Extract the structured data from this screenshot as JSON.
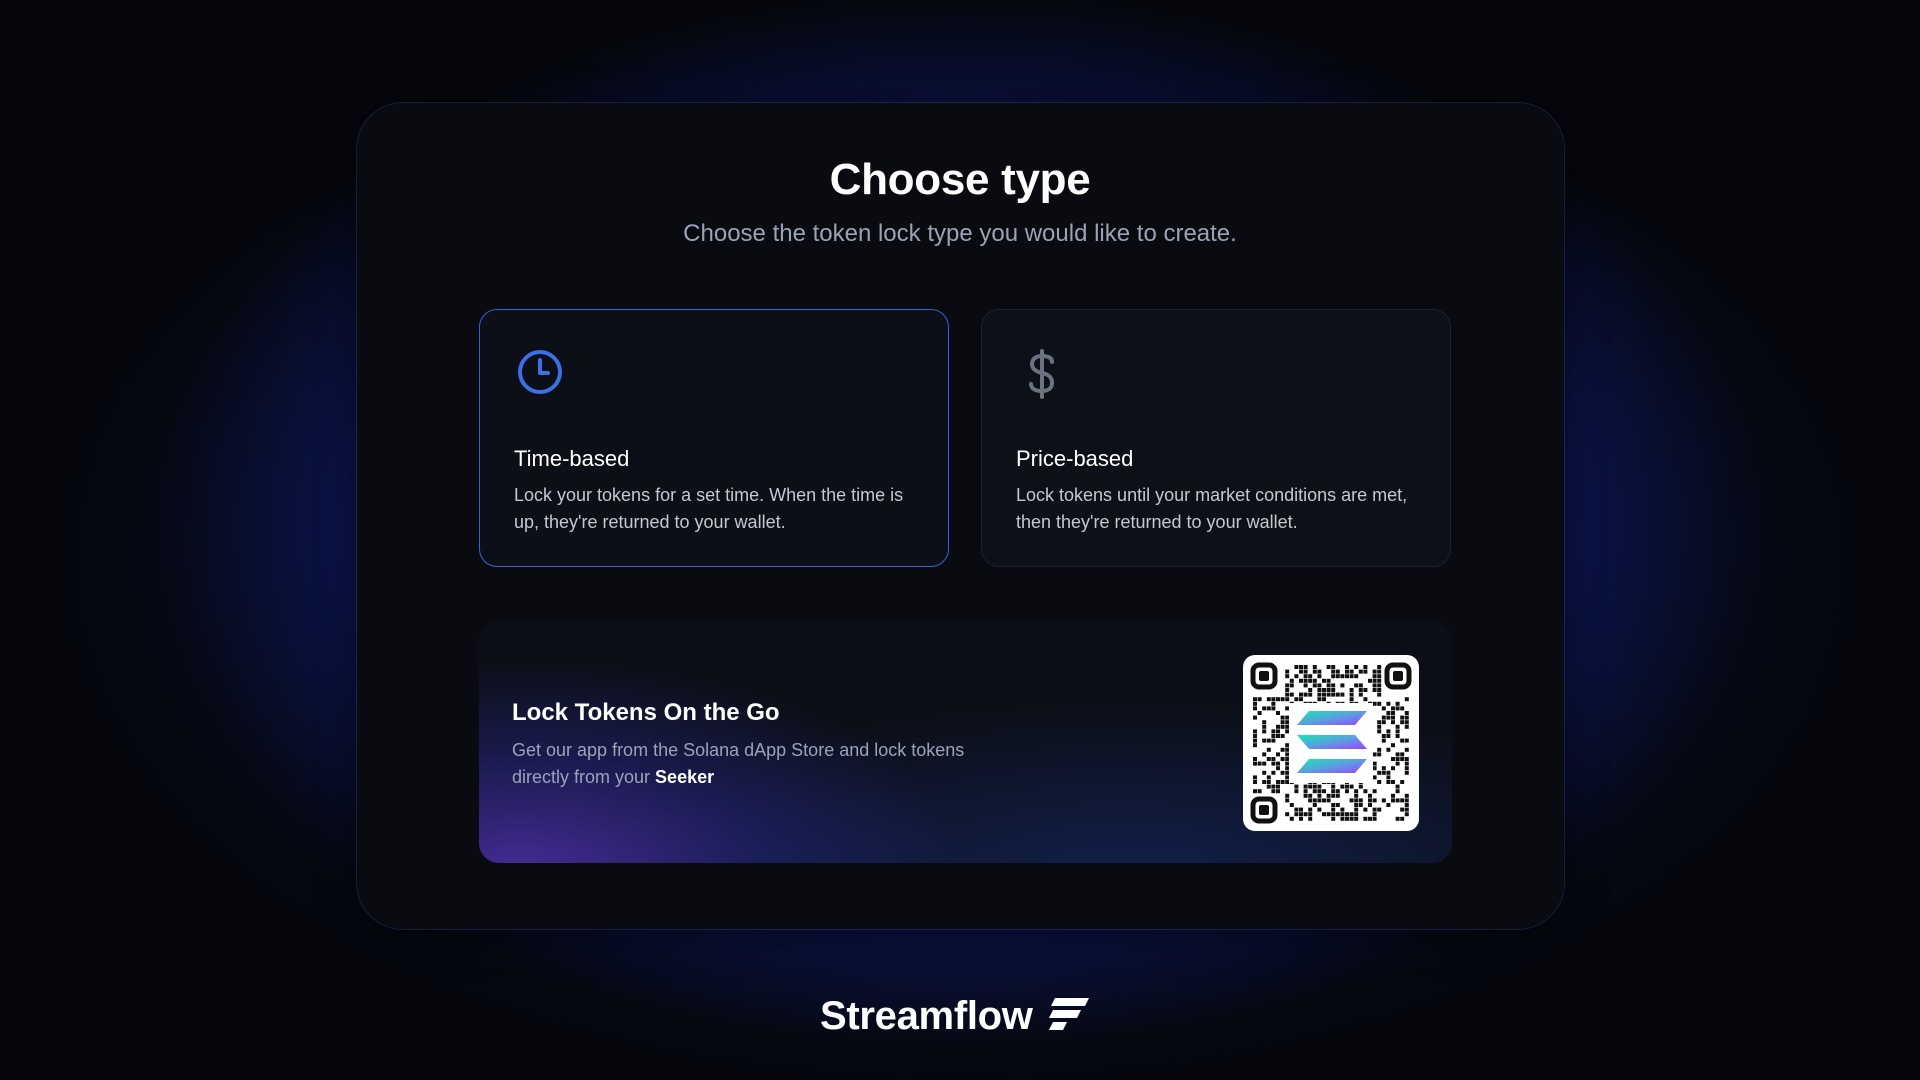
{
  "header": {
    "title": "Choose type",
    "subtitle": "Choose the token lock type you would like to create."
  },
  "options": [
    {
      "title": "Time-based",
      "description": "Lock your tokens for a set time. When the time is up, they're returned to your wallet.",
      "icon": "clock-icon",
      "selected": true
    },
    {
      "title": "Price-based",
      "description": "Lock tokens until your market conditions are met, then they're returned to your wallet.",
      "icon": "dollar-icon",
      "selected": false
    }
  ],
  "promo": {
    "title": "Lock Tokens On the Go",
    "text_prefix": "Get our app from the Solana dApp Store and lock tokens directly from your ",
    "text_emphasis": "Seeker"
  },
  "brand": {
    "name": "Streamflow"
  },
  "colors": {
    "accent": "#3463d6",
    "background_glow": "#2850ff",
    "panel": "#090b10"
  }
}
